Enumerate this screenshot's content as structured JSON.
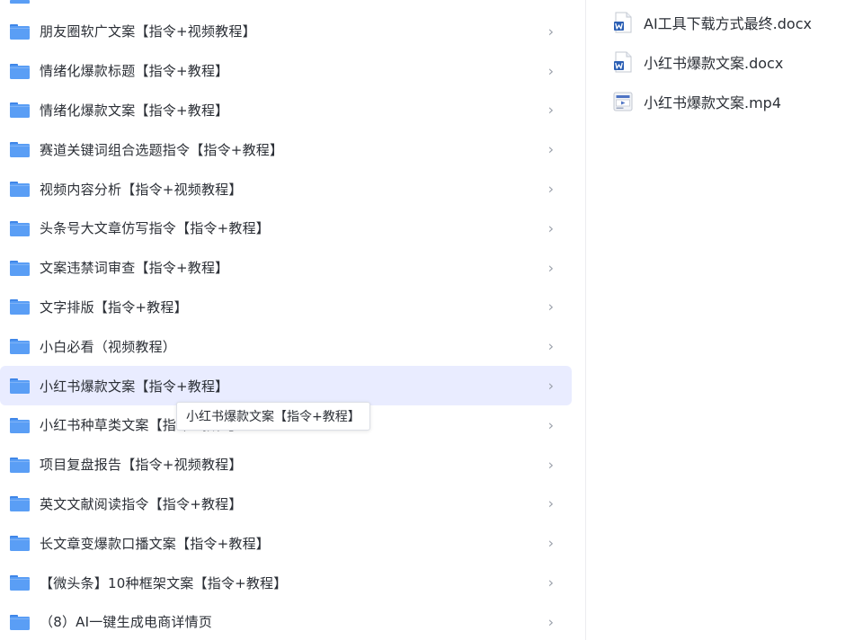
{
  "folders": [
    {
      "label": "朋友圈软广文案【指令+视频教程】"
    },
    {
      "label": "情绪化爆款标题【指令+教程】"
    },
    {
      "label": "情绪化爆款文案【指令+教程】"
    },
    {
      "label": "赛道关键词组合选题指令【指令+教程】"
    },
    {
      "label": "视频内容分析【指令+视频教程】"
    },
    {
      "label": "头条号大文章仿写指令【指令+教程】"
    },
    {
      "label": "文案违禁词审查【指令+教程】"
    },
    {
      "label": "文字排版【指令+教程】"
    },
    {
      "label": "小白必看（视频教程）"
    },
    {
      "label": "小红书爆款文案【指令+教程】",
      "selected": true
    },
    {
      "label": "小红书种草类文案【指令+教程】"
    },
    {
      "label": "项目复盘报告【指令+视频教程】"
    },
    {
      "label": "英文文献阅读指令【指令+教程】"
    },
    {
      "label": "长文章变爆款口播文案【指令+教程】"
    },
    {
      "label": "【微头条】10种框架文案【指令+教程】"
    },
    {
      "label": "（8）AI一键生成电商详情页"
    }
  ],
  "chevron_glyph": "›",
  "tooltip": {
    "text": "小红书爆款文案【指令+教程】"
  },
  "files": [
    {
      "label": "AI工具下载方式最终.docx",
      "icon": "word-doc-icon"
    },
    {
      "label": "小红书爆款文案.docx",
      "icon": "word-doc-icon"
    },
    {
      "label": "小红书爆款文案.mp4",
      "icon": "video-file-icon"
    }
  ],
  "colors": {
    "folder": "#5a9ef5",
    "folder_tab": "#3f86e8",
    "selected_row": "#e9ecff",
    "word_blue": "#2b5fb4"
  }
}
